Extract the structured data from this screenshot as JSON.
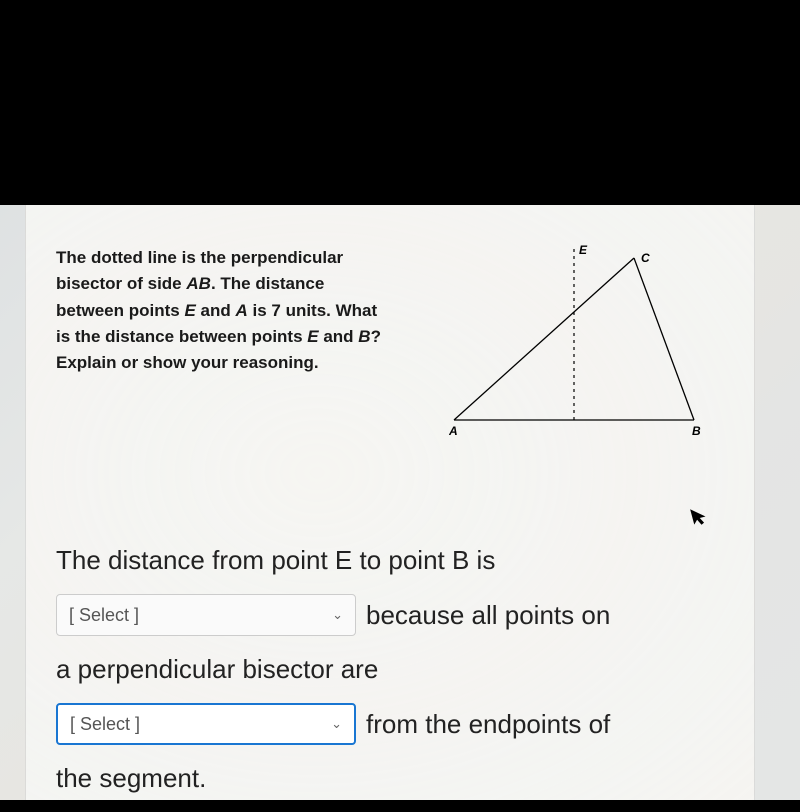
{
  "question": {
    "line1_pre": "The dotted line is the perpendicular bisector of side ",
    "side": "AB",
    "line1_post": ". The distance between points ",
    "ptE1": "E",
    "and1": " and ",
    "ptA": "A",
    "mid": " is 7 units. What is the distance between points ",
    "ptE2": "E",
    "and2": " and ",
    "ptB": "B",
    "tail": "? Explain or show your reasoning."
  },
  "figure": {
    "labels": {
      "A": "A",
      "B": "B",
      "C": "C",
      "E": "E"
    }
  },
  "answer": {
    "lead": "The distance from point E to point B is",
    "select_placeholder": "[ Select ]",
    "because": "because all points on",
    "perp": "a perpendicular bisector are",
    "from": "from the endpoints of",
    "seg": "the segment."
  }
}
